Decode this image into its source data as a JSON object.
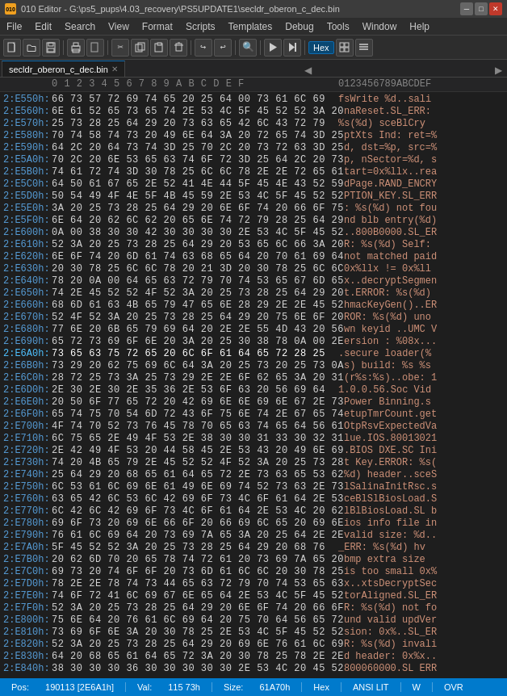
{
  "titlebar": {
    "icon": "010",
    "title": "010 Editor - G:\\ps5_pups\\4.03_recovery\\PS5UPDATE1\\secldr_oberon_c_dec.bin",
    "minimize": "─",
    "maximize": "□",
    "close": "✕"
  },
  "menubar": {
    "items": [
      "File",
      "Edit",
      "Search",
      "View",
      "Format",
      "Scripts",
      "Templates",
      "Debug",
      "Tools",
      "Window",
      "Help"
    ]
  },
  "toolbar": {
    "hex_label": "Hex",
    "ansi_lit_label": "ANSI LIT"
  },
  "tab": {
    "name": "secldr_oberon_c_dec.bin",
    "active": true
  },
  "columns": {
    "addr_header": "        ",
    "hex_header": " 0  1  2  3  4  5  6  7  8  9  A  B  C  D  E  F",
    "ascii_header": "0123456789ABCDEF"
  },
  "rows": [
    {
      "addr": "2:E550h:",
      "hex": "66 73 57 72 69 74 65 20 25 64 00 73 61 6C 69",
      "ascii": "fsWrite %d..sali"
    },
    {
      "addr": "2:E560h:",
      "hex": "6E 61 52 65 73 65 74 2E 53 4C 5F 45 52 52 3A 20",
      "ascii": "naReset.SL_ERR: "
    },
    {
      "addr": "2:E570h:",
      "hex": "25 73 28 25 64 29 20 73 63 65 42 6C 43 72 79",
      "ascii": "%s(%d) sceBlCry"
    },
    {
      "addr": "2:E580h:",
      "hex": "70 74 58 74 73 20 49 6E 64 3A 20 72 65 74 3D 25",
      "ascii": "ptXts Ind: ret=%"
    },
    {
      "addr": "2:E590h:",
      "hex": "64 2C 20 64 73 74 3D 25 70 2C 20 73 72 63 3D 25",
      "ascii": "d, dst=%p, src=%"
    },
    {
      "addr": "2:E5A0h:",
      "hex": "70 2C 20 6E 53 65 63 74 6F 72 3D 25 64 2C 20 73",
      "ascii": "p, nSector=%d, s"
    },
    {
      "addr": "2:E5B0h:",
      "hex": "74 61 72 74 3D 30 78 25 6C 6C 78 2E 2E 72 65 61",
      "ascii": "tart=0x%llx..rea"
    },
    {
      "addr": "2:E5C0h:",
      "hex": "64 50 61 67 65 2E 52 41 4E 44 5F 45 4E 43 52 59",
      "ascii": "dPage.RAND_ENCRY"
    },
    {
      "addr": "2:E5D0h:",
      "hex": "50 54 49 4F 4E 5F 4B 45 59 2E 53 4C 5F 45 52 52",
      "ascii": "PTION_KEY.SL_ERR"
    },
    {
      "addr": "2:E5E0h:",
      "hex": "3A 20 25 73 28 25 64 29 20 6E 6F 74 20 66 6F 75",
      "ascii": ": %s(%d) not fou"
    },
    {
      "addr": "2:E5F0h:",
      "hex": "6E 64 20 62 6C 62 20 65 6E 74 72 79 28 25 64 29",
      "ascii": "nd blb entry(%d)"
    },
    {
      "addr": "2:E600h:",
      "hex": "0A 00 38 30 30 42 30 30 30 30 2E 53 4C 5F 45 52",
      "ascii": "..800B0000.SL_ER"
    },
    {
      "addr": "2:E610h:",
      "hex": "52 3A 20 25 73 28 25 64 29 20 53 65 6C 66 3A 20",
      "ascii": "R: %s(%d) Self: "
    },
    {
      "addr": "2:E620h:",
      "hex": "6E 6F 74 20 6D 61 74 63 68 65 64 20 70 61 69 64",
      "ascii": "not matched paid"
    },
    {
      "addr": "2:E630h:",
      "hex": "20 30 78 25 6C 6C 78 20 21 3D 20 30 78 25 6C 6C",
      "ascii": " 0x%llx != 0x%ll"
    },
    {
      "addr": "2:E640h:",
      "hex": "78 20 0A 00 64 65 63 72 79 70 74 53 65 67 6D 65",
      "ascii": "x..decryptSegmen"
    },
    {
      "addr": "2:E650h:",
      "hex": "74 2E 45 52 52 4F 52 3A 20 25 73 28 25 64 29 20",
      "ascii": "t.ERROR: %s(%d) "
    },
    {
      "addr": "2:E660h:",
      "hex": "68 6D 61 63 4B 65 79 47 65 6E 28 29 2E 2E 45 52",
      "ascii": "hmacKeyGen()..ER"
    },
    {
      "addr": "2:E670h:",
      "hex": "52 4F 52 3A 20 25 73 28 25 64 29 20 75 6E 6F 20",
      "ascii": "ROR: %s(%d) uno "
    },
    {
      "addr": "2:E680h:",
      "hex": "77 6E 20 6B 65 79 69 64 20 2E 2E 55 4D 43 20 56",
      "ascii": "wn keyid ..UMC V"
    },
    {
      "addr": "2:E690h:",
      "hex": "65 72 73 69 6F 6E 20 3A 20 25 30 38 78 0A 00 2E",
      "ascii": "ersion : %08x..."
    },
    {
      "addr": "2:E6A0h:",
      "hex": "73 65 63 75 72 65 20 6C 6F 61 64 65 72 28 25",
      "ascii": ".secure loader(%",
      "highlight": true
    },
    {
      "addr": "2:E6B0h:",
      "hex": "73 29 20 62 75 69 6C 64 3A 20 25 73 20 25 73 0A",
      "ascii": "s) build: %s %s"
    },
    {
      "addr": "2:E6C0h:",
      "hex": "28 72 25 73 3A 25 73 29 2E 2E 6F 62 65 3A 20 31",
      "ascii": "(r%s:%s)..obe: 1"
    },
    {
      "addr": "2:E6D0h:",
      "hex": "2E 30 2E 30 2E 35 36 2E 53 6F 63 20 56 69 64",
      "ascii": "1.0.0.56.Soc Vid"
    },
    {
      "addr": "2:E6E0h:",
      "hex": "20 50 6F 77 65 72 20 42 69 6E 6E 69 6E 67 2E 73",
      "ascii": " Power Binning.s"
    },
    {
      "addr": "2:E6F0h:",
      "hex": "65 74 75 70 54 6D 72 43 6F 75 6E 74 2E 67 65 74",
      "ascii": "etupTmrCount.get"
    },
    {
      "addr": "2:E700h:",
      "hex": "4F 74 70 52 73 76 45 78 70 65 63 74 65 64 56 61",
      "ascii": "OtpRsvExpectedVa"
    },
    {
      "addr": "2:E710h:",
      "hex": "6C 75 65 2E 49 4F 53 2E 38 30 30 31 33 30 32 31",
      "ascii": "lue.IOS.80013021"
    },
    {
      "addr": "2:E720h:",
      "hex": "2E 42 49 4F 53 20 44 58 45 2E 53 43 20 49 6E 69",
      "ascii": ".BIOS DXE.SC Ini"
    },
    {
      "addr": "2:E730h:",
      "hex": "74 20 4B 65 79 2E 45 52 52 4F 52 3A 20 25 73 28",
      "ascii": "t Key.ERROR: %s("
    },
    {
      "addr": "2:E740h:",
      "hex": "25 64 29 20 68 65 61 64 65 72 2E 73 63 65 53 62",
      "ascii": "%d) header..sceS"
    },
    {
      "addr": "2:E750h:",
      "hex": "6C 53 61 6C 69 6E 61 49 6E 69 74 52 73 63 2E 73",
      "ascii": "lSalinaInitRsc.s"
    },
    {
      "addr": "2:E760h:",
      "hex": "63 65 42 6C 53 6C 42 69 6F 73 4C 6F 61 64 2E 53",
      "ascii": "ceBlSlBiosLoad.S"
    },
    {
      "addr": "2:E770h:",
      "hex": "6C 42 6C 42 69 6F 73 4C 6F 61 64 2E 53 4C 20 62",
      "ascii": "lBlBiosLoad.SL b"
    },
    {
      "addr": "2:E780h:",
      "hex": "69 6F 73 20 69 6E 66 6F 20 66 69 6C 65 20 69 6E",
      "ascii": "ios info file in"
    },
    {
      "addr": "2:E790h:",
      "hex": "76 61 6C 69 64 20 73 69 7A 65 3A 20 25 64 2E 2E",
      "ascii": "valid size: %d.."
    },
    {
      "addr": "2:E7A0h:",
      "hex": "5F 45 52 52 3A 20 25 73 28 25 64 29 20 68 76",
      "ascii": "_ERR: %s(%d) hv"
    },
    {
      "addr": "2:E7B0h:",
      "hex": "20 62 6D 70 20 65 78 74 72 61 20 73 69 7A 65 20",
      "ascii": " bmp extra size "
    },
    {
      "addr": "2:E7C0h:",
      "hex": "69 73 20 74 6F 6F 20 73 6D 61 6C 6C 20 30 78 25",
      "ascii": "is too small 0x%"
    },
    {
      "addr": "2:E7D0h:",
      "hex": "78 2E 2E 78 74 73 44 65 63 72 79 70 74 53 65 63",
      "ascii": "x..xtsDecryptSec"
    },
    {
      "addr": "2:E7E0h:",
      "hex": "74 6F 72 41 6C 69 67 6E 65 64 2E 53 4C 5F 45 52",
      "ascii": "torAligned.SL_ER"
    },
    {
      "addr": "2:E7F0h:",
      "hex": "52 3A 20 25 73 28 25 64 29 20 6E 6F 74 20 66 6F",
      "ascii": "R: %s(%d) not fo"
    },
    {
      "addr": "2:E800h:",
      "hex": "75 6E 64 20 76 61 6C 69 64 20 75 70 64 56 65 72",
      "ascii": "und valid updVer"
    },
    {
      "addr": "2:E810h:",
      "hex": "73 69 6F 6E 3A 20 30 78 25 2E 53 4C 5F 45 52 52",
      "ascii": "sion: 0x%..SL_ER"
    },
    {
      "addr": "2:E820h:",
      "hex": "52 3A 20 25 73 28 25 64 29 20 69 6E 76 61 6C 69",
      "ascii": "R: %s(%d) invali"
    },
    {
      "addr": "2:E830h:",
      "hex": "64 20 68 65 61 64 65 72 3A 20 30 78 25 78 2E 2E",
      "ascii": "d header: 0x%x.."
    },
    {
      "addr": "2:E840h:",
      "hex": "38 30 30 30 36 30 30 30 30 30 2E 53 4C 20 45 52",
      "ascii": "800060000.SL ERR"
    }
  ],
  "statusbar": {
    "pos_label": "Pos:",
    "pos_value": "190113 [2E6A1h]",
    "val_label": "Val:",
    "val_value": "115 73h",
    "size_label": "Size:",
    "size_value": "61A70h",
    "hex_label": "Hex",
    "ansi_label": "ANSI LIT",
    "w_label": "W",
    "ovr_label": "OVR"
  }
}
